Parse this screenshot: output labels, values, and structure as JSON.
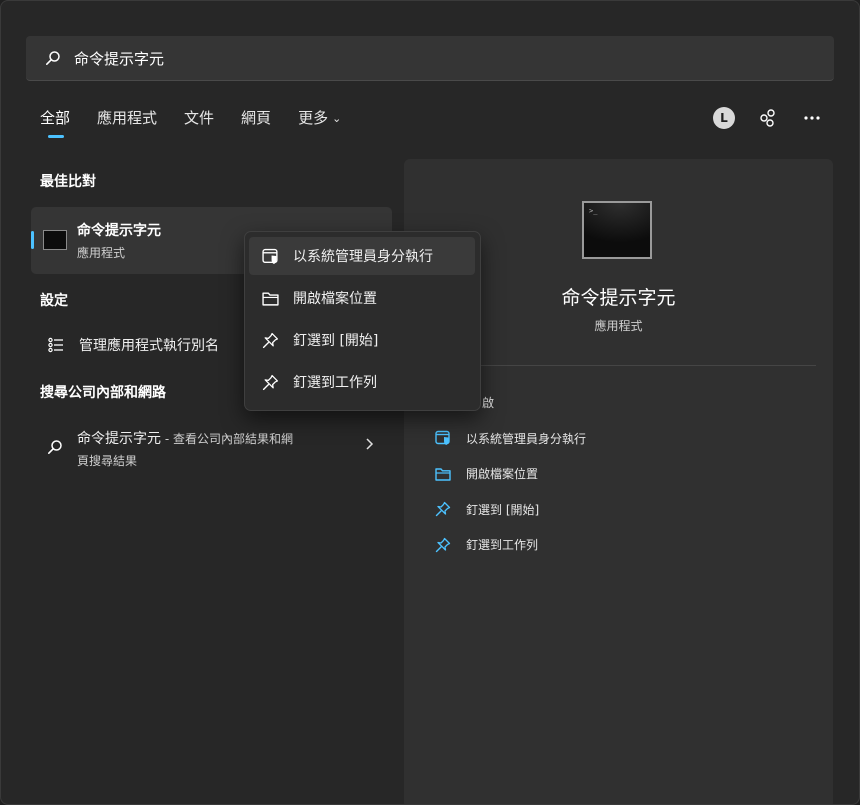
{
  "search": {
    "value": "命令提示字元"
  },
  "tabs": [
    {
      "label": "全部"
    },
    {
      "label": "應用程式"
    },
    {
      "label": "文件"
    },
    {
      "label": "網頁"
    },
    {
      "label": "更多"
    }
  ],
  "header": {
    "avatar_letter": "L"
  },
  "sections": {
    "best_match": "最佳比對",
    "settings": "設定",
    "web": "搜尋公司內部和網路"
  },
  "best_match": {
    "title": "命令提示字元",
    "subtitle": "應用程式"
  },
  "settings_item": {
    "label": "管理應用程式執行別名"
  },
  "web_item": {
    "title": "命令提示字元",
    "suffix": " - 查看公司內部結果和網",
    "line2": "頁搜尋結果"
  },
  "context_menu": [
    {
      "label": "以系統管理員身分執行",
      "icon": "shield-window-icon"
    },
    {
      "label": "開啟檔案位置",
      "icon": "folder-icon"
    },
    {
      "label": "釘選到 [開始]",
      "icon": "pin-icon"
    },
    {
      "label": "釘選到工作列",
      "icon": "pin-icon"
    }
  ],
  "right_pane": {
    "title": "命令提示字元",
    "subtitle": "應用程式",
    "actions": [
      {
        "label": "啟",
        "icon": "open-icon"
      },
      {
        "label": "以系統管理員身分執行",
        "icon": "shield-window-icon"
      },
      {
        "label": "開啟檔案位置",
        "icon": "folder-icon"
      },
      {
        "label": "釘選到 [開始]",
        "icon": "pin-icon"
      },
      {
        "label": "釘選到工作列",
        "icon": "pin-icon"
      }
    ]
  },
  "colors": {
    "accent": "#4cc2ff",
    "background": "#272727",
    "pane": "#303030"
  }
}
